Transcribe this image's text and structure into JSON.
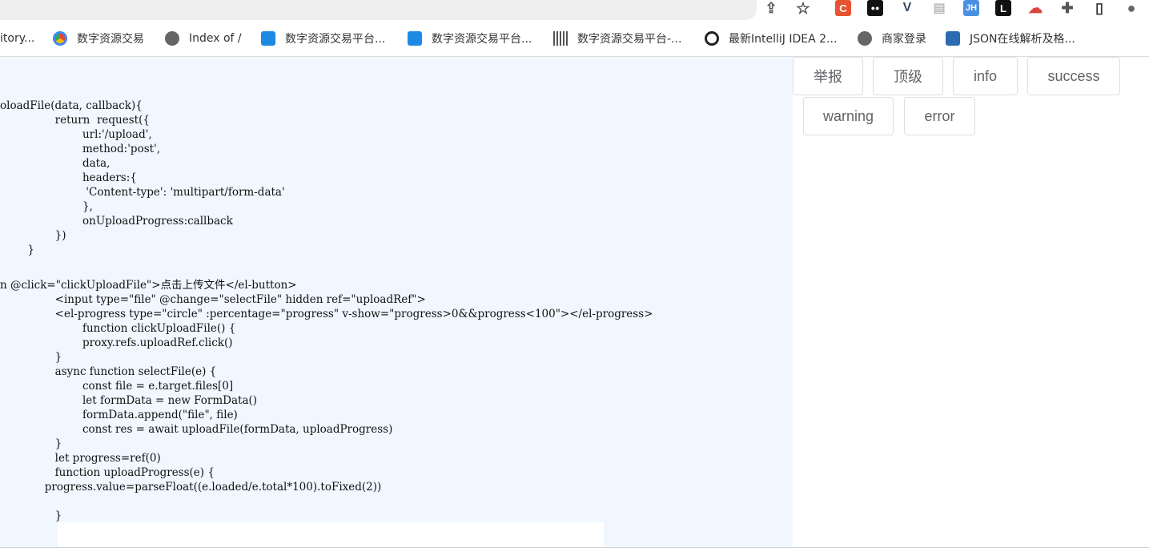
{
  "toolbar_icons": [
    {
      "name": "share-icon",
      "glyph": "⇪"
    },
    {
      "name": "star-icon",
      "glyph": "☆"
    },
    {
      "name": "csdn-extension-icon",
      "glyph": "C",
      "color": "#e8532f"
    },
    {
      "name": "tampermonkey-extension-icon",
      "glyph": "●●",
      "color": "#111111"
    },
    {
      "name": "vue-devtools-extension-icon",
      "glyph": "V",
      "color": "#34495e"
    },
    {
      "name": "document-extension-icon",
      "glyph": "▤",
      "color": "#cccccc"
    },
    {
      "name": "jh-extension-icon",
      "glyph": "JH",
      "color": "#4a90e2"
    },
    {
      "name": "l-extension-icon",
      "glyph": "L",
      "color": "#111111"
    },
    {
      "name": "cloud-extension-icon",
      "glyph": "☁",
      "color": "#d9463c"
    },
    {
      "name": "puzzle-extensions-icon",
      "glyph": "✚",
      "color": "#555555"
    },
    {
      "name": "side-panel-icon",
      "glyph": "▯",
      "color": "#333333"
    },
    {
      "name": "profile-avatar-icon",
      "glyph": "●",
      "color": "#666666"
    }
  ],
  "bookmarks": [
    {
      "label": "itory...",
      "icon": "none"
    },
    {
      "label": "数字资源交易",
      "icon": "chrome-icon"
    },
    {
      "label": "Index of /",
      "icon": "globe-icon"
    },
    {
      "label": "数字资源交易平台...",
      "icon": "app-icon"
    },
    {
      "label": "数字资源交易平台...",
      "icon": "app-icon"
    },
    {
      "label": "数字资源交易平台-...",
      "icon": "barcode-icon"
    },
    {
      "label": "最新IntelliJ IDEA 2...",
      "icon": "b-icon"
    },
    {
      "label": "商家登录",
      "icon": "globe-icon"
    },
    {
      "label": "JSON在线解析及格...",
      "icon": "json-icon"
    }
  ],
  "code_lines": [
    "oloadFile(data, callback){",
    "                return  request({",
    "                        url:'/upload',",
    "                        method:'post',",
    "                        data,",
    "                        headers:{",
    "                         'Content-type': 'multipart/form-data'",
    "                        },",
    "                        onUploadProgress:callback",
    "                })",
    "        }",
    "",
    "n @click=\"clickUploadFile\">点击上传文件</el-button>",
    "                <input type=\"file\" @change=\"selectFile\" hidden ref=\"uploadRef\">",
    "                <el-progress type=\"circle\" :percentage=\"progress\" v-show=\"progress>0&&progress<100\"></el-progress>",
    "                        function clickUploadFile() {",
    "                        proxy.refs.uploadRef.click()",
    "                }",
    "                async function selectFile(e) {",
    "                        const file = e.target.files[0]",
    "                        let formData = new FormData()",
    "                        formData.append(\"file\", file)",
    "                        const res = await uploadFile(formData, uploadProgress)",
    "                }",
    "                let progress=ref(0)",
    "                function uploadProgress(e) {",
    "             progress.value=parseFloat((e.loaded/e.total*100).toFixed(2))",
    "",
    "                }"
  ],
  "buttons": [
    {
      "label": "举报",
      "name": "report-button"
    },
    {
      "label": "顶级",
      "name": "top-level-button"
    },
    {
      "label": "info",
      "name": "info-button"
    },
    {
      "label": "success",
      "name": "success-button"
    },
    {
      "label": "warning",
      "name": "warning-button"
    },
    {
      "label": "error",
      "name": "error-button"
    }
  ]
}
